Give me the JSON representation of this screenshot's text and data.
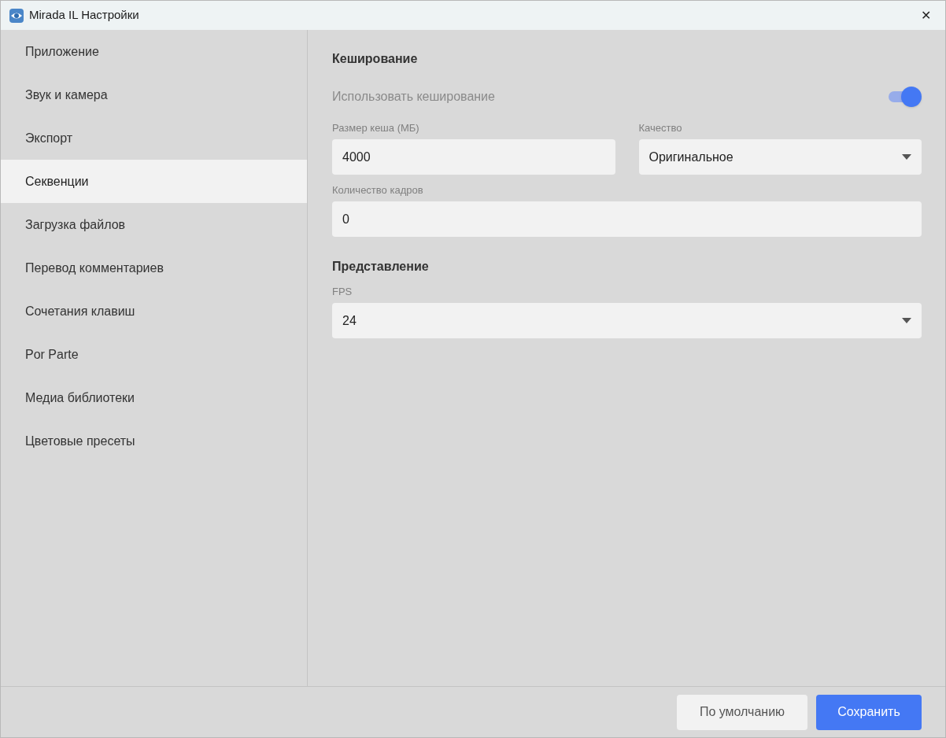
{
  "window": {
    "title": "Mirada IL Настройки",
    "close": "✕"
  },
  "sidebar": {
    "items": [
      {
        "label": "Приложение",
        "selected": false
      },
      {
        "label": "Звук и камера",
        "selected": false
      },
      {
        "label": "Экспорт",
        "selected": false
      },
      {
        "label": "Секвенции",
        "selected": true
      },
      {
        "label": "Загрузка файлов",
        "selected": false
      },
      {
        "label": "Перевод комментариев",
        "selected": false
      },
      {
        "label": "Сочетания клавиш",
        "selected": false
      },
      {
        "label": "Por Parte",
        "selected": false
      },
      {
        "label": "Медиа библиотеки",
        "selected": false
      },
      {
        "label": "Цветовые пресеты",
        "selected": false
      }
    ]
  },
  "sections": [
    {
      "title": "Кеширование",
      "rows": [
        {
          "kind": "toggle",
          "label": "Использовать кеширование",
          "on": true
        },
        {
          "kind": "fields",
          "fields": [
            {
              "kind": "input",
              "label": "Размер кеша (МБ)",
              "value": "4000"
            },
            {
              "kind": "select",
              "label": "Качество",
              "value": "Оригинальное"
            }
          ]
        },
        {
          "kind": "fields",
          "fields": [
            {
              "kind": "input",
              "label": "Количество кадров",
              "value": "0"
            }
          ]
        }
      ]
    },
    {
      "title": "Представление",
      "rows": [
        {
          "kind": "fields",
          "fields": [
            {
              "kind": "select",
              "label": "FPS",
              "value": "24"
            }
          ]
        }
      ]
    }
  ],
  "footer": {
    "buttons": [
      {
        "label": "По умолчанию",
        "kind": "secondary"
      },
      {
        "label": "Сохранить",
        "kind": "primary"
      }
    ]
  }
}
